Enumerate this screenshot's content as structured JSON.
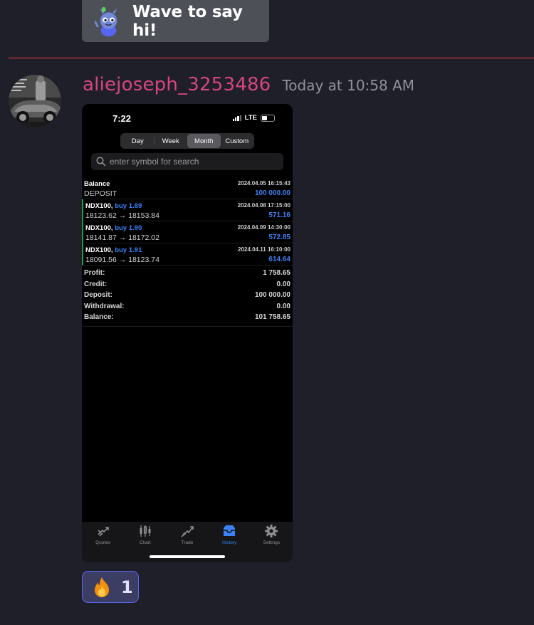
{
  "wave": {
    "label": "Wave to say hi!"
  },
  "message": {
    "username": "aliejoseph_3253486",
    "timestamp": "Today at 10:58 AM",
    "avatar_icon": "user-avatar-car-icon"
  },
  "phone": {
    "status": {
      "time": "7:22",
      "network": "LTE"
    },
    "segments": [
      {
        "label": "Day",
        "active": false
      },
      {
        "label": "Week",
        "active": false
      },
      {
        "label": "Month",
        "active": true
      },
      {
        "label": "Custom",
        "active": false
      }
    ],
    "search": {
      "placeholder": "enter symbol for search"
    },
    "rows": [
      {
        "title": "Balance",
        "buy": "",
        "date": "2024.04.05 16:15:43",
        "detail": "DEPOSIT",
        "amount": "100 000.00"
      },
      {
        "title": "NDX100,",
        "buy": "buy 1.89",
        "date": "2024.04.08 17:15:00",
        "detail": "18123.62 → 18153.84",
        "amount": "571.16"
      },
      {
        "title": "NDX100,",
        "buy": "buy 1.90",
        "date": "2024.04.09 14:30:00",
        "detail": "18141.87 → 18172.02",
        "amount": "572.85"
      },
      {
        "title": "NDX100,",
        "buy": "buy 1.91",
        "date": "2024.04.11 16:10:00",
        "detail": "18091.56 → 18123.74",
        "amount": "614.64"
      }
    ],
    "summary": [
      {
        "label": "Profit:",
        "value": "1 758.65"
      },
      {
        "label": "Credit:",
        "value": "0.00"
      },
      {
        "label": "Deposit:",
        "value": "100 000.00"
      },
      {
        "label": "Withdrawal:",
        "value": "0.00"
      },
      {
        "label": "Balance:",
        "value": "101 758.65"
      }
    ],
    "tabs": [
      {
        "label": "Quotes",
        "icon": "quotes-icon",
        "active": false
      },
      {
        "label": "Chart",
        "icon": "chart-icon",
        "active": false
      },
      {
        "label": "Trade",
        "icon": "trade-icon",
        "active": false
      },
      {
        "label": "History",
        "icon": "history-icon",
        "active": true
      },
      {
        "label": "Settings",
        "icon": "settings-icon",
        "active": false
      }
    ],
    "colors": {
      "accent": "#3b82f6",
      "deal_bar": "#1f9e45"
    }
  },
  "reaction": {
    "emoji": "fire",
    "count": "1"
  },
  "colors": {
    "background": "#1f1f29",
    "username": "#d64580",
    "divider": "#f23f43",
    "reaction_border": "#5865f2"
  }
}
